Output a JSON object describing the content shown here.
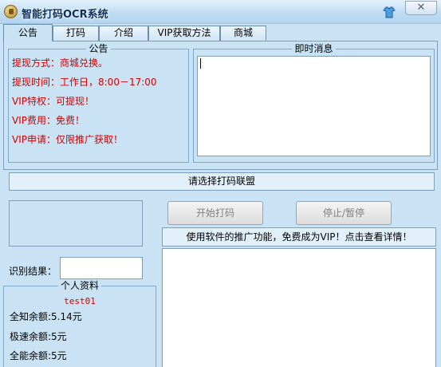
{
  "window": {
    "title": "智能打码OCR系统",
    "close_label": "✕"
  },
  "tabs": [
    {
      "label": "公告",
      "active": true
    },
    {
      "label": "打码",
      "active": false
    },
    {
      "label": "介绍",
      "active": false
    },
    {
      "label": "VIP获取方法",
      "active": false
    },
    {
      "label": "商城",
      "active": false
    }
  ],
  "notice": {
    "title": "公告",
    "lines": [
      "提现方式：商城兑换。",
      "提现时间：工作日，8:00－17:00",
      "VIP特权：可提现！",
      "VIP费用：免费！",
      "VIP申请：仅限推广获取！"
    ]
  },
  "news": {
    "title": "即时消息",
    "content": ""
  },
  "alliance": {
    "prompt": "请选择打码联盟"
  },
  "controls": {
    "start_label": "开始打码",
    "stop_label": "停止/暂停"
  },
  "promo": {
    "text": "使用软件的推广功能，免费成为VIP！点击查看详情！"
  },
  "recognition": {
    "label": "识别结果：",
    "value": ""
  },
  "profile": {
    "title": "个人资料",
    "username": "test01",
    "balances": [
      "全知余额:5.14元",
      "极速余额:5元",
      "全能余额:5元"
    ]
  },
  "colors": {
    "background": "#c9e3f5",
    "notice_text": "#d40000",
    "border": "#7f9db9"
  }
}
